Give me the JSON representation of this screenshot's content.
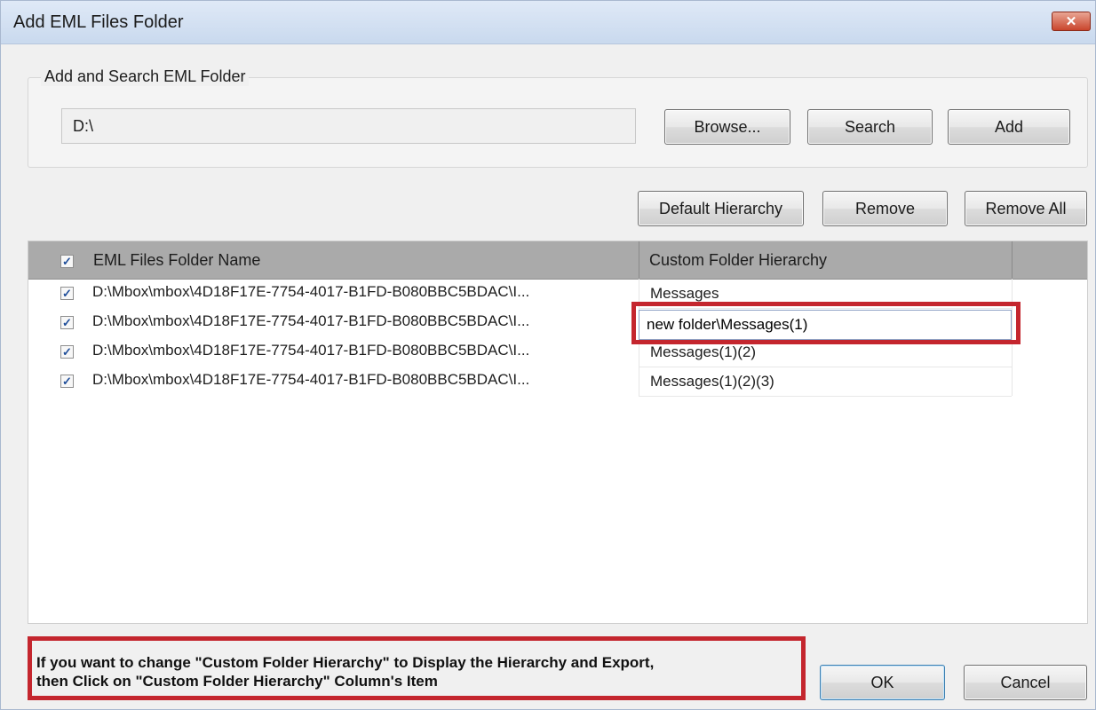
{
  "window": {
    "title": "Add EML Files Folder",
    "close_glyph": "✕"
  },
  "group": {
    "label": "Add and Search EML Folder",
    "path_value": "D:\\",
    "browse_label": "Browse...",
    "search_label": "Search",
    "add_label": "Add"
  },
  "actions": {
    "default_hierarchy_label": "Default Hierarchy",
    "remove_label": "Remove",
    "remove_all_label": "Remove All"
  },
  "table": {
    "col1_header": "EML Files Folder Name",
    "col2_header": "Custom Folder Hierarchy",
    "header_checked": true,
    "rows": [
      {
        "checked": true,
        "folder": "D:\\Mbox\\mbox\\4D18F17E-7754-4017-B1FD-B080BBC5BDAC\\I...",
        "hierarchy": "Messages"
      },
      {
        "checked": true,
        "folder": "D:\\Mbox\\mbox\\4D18F17E-7754-4017-B1FD-B080BBC5BDAC\\I...",
        "hierarchy": "new folder\\Messages(1)"
      },
      {
        "checked": true,
        "folder": "D:\\Mbox\\mbox\\4D18F17E-7754-4017-B1FD-B080BBC5BDAC\\I...",
        "hierarchy": "Messages(1)(2)"
      },
      {
        "checked": true,
        "folder": "D:\\Mbox\\mbox\\4D18F17E-7754-4017-B1FD-B080BBC5BDAC\\I...",
        "hierarchy": "Messages(1)(2)(3)"
      }
    ]
  },
  "info": {
    "line1": "If you want to change \"Custom Folder Hierarchy\" to Display the Hierarchy and Export,",
    "line2": "then Click on \"Custom Folder Hierarchy\" Column's Item"
  },
  "footer": {
    "ok_label": "OK",
    "cancel_label": "Cancel"
  },
  "colors": {
    "highlight": "#c4262e",
    "header_bg": "#aaaaaa",
    "titlebar": "#c9d9ee"
  },
  "checkbox_glyph": "✓"
}
